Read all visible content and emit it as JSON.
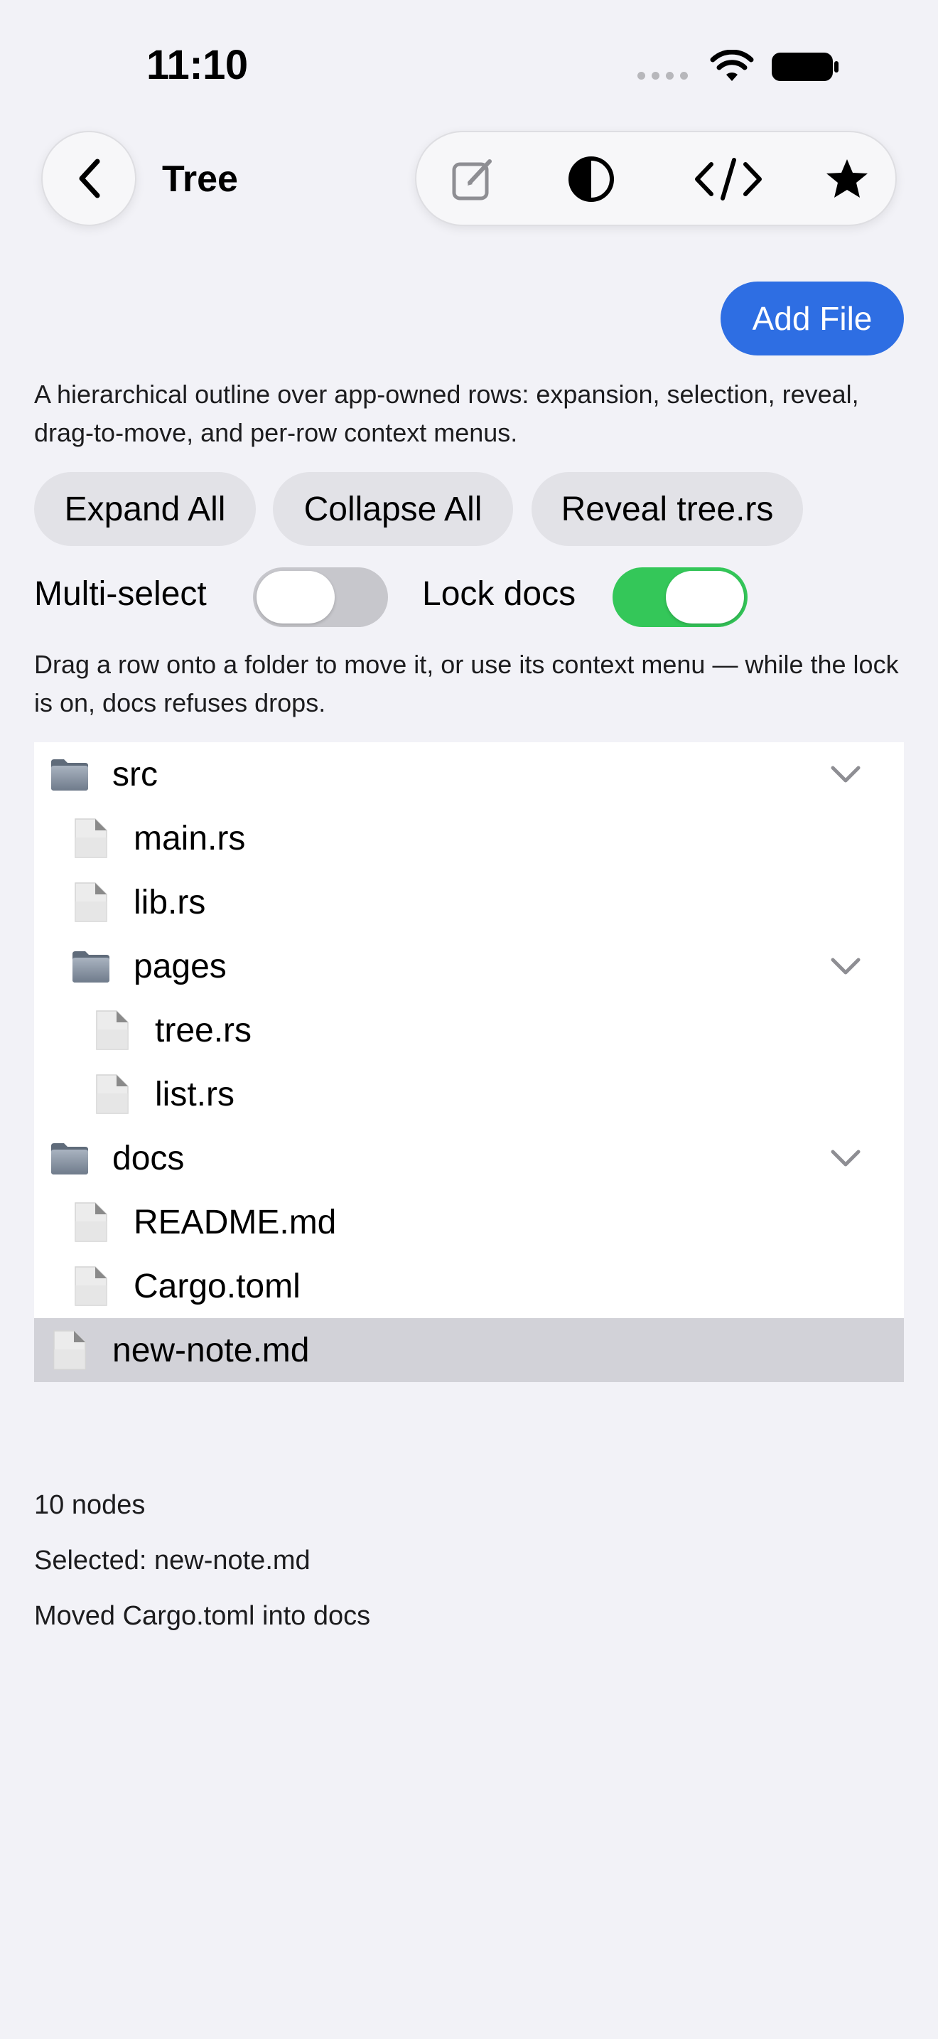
{
  "status": {
    "time": "11:10"
  },
  "nav": {
    "title": "Tree"
  },
  "toolbar": {
    "items": [
      {
        "icon": "compose-icon"
      },
      {
        "icon": "contrast-icon"
      },
      {
        "icon": "code-icon"
      },
      {
        "icon": "star-icon"
      }
    ]
  },
  "actions": {
    "add_file": "Add File"
  },
  "description": "A hierarchical outline over app-owned rows: expansion, selection, reveal, drag-to-move, and per-row context menus.",
  "buttons": {
    "expand_all": "Expand All",
    "collapse_all": "Collapse All",
    "reveal": "Reveal tree.rs"
  },
  "toggles": {
    "multi_select": {
      "label": "Multi-select",
      "on": false
    },
    "lock_docs": {
      "label": "Lock docs",
      "on": true
    }
  },
  "hint": "Drag a row onto a folder to move it, or use its context menu — while the lock is on, docs refuses drops.",
  "tree": {
    "rows": [
      {
        "label": "src",
        "type": "folder",
        "depth": 0,
        "expanded": true
      },
      {
        "label": "main.rs",
        "type": "file",
        "depth": 1
      },
      {
        "label": "lib.rs",
        "type": "file",
        "depth": 1
      },
      {
        "label": "pages",
        "type": "folder",
        "depth": 1,
        "expanded": true
      },
      {
        "label": "tree.rs",
        "type": "file",
        "depth": 2
      },
      {
        "label": "list.rs",
        "type": "file",
        "depth": 2
      },
      {
        "label": "docs",
        "type": "folder",
        "depth": 0,
        "expanded": true
      },
      {
        "label": "README.md",
        "type": "file",
        "depth": 1
      },
      {
        "label": "Cargo.toml",
        "type": "file",
        "depth": 1
      },
      {
        "label": "new-note.md",
        "type": "file",
        "depth": 0,
        "selected": true
      }
    ]
  },
  "footer": {
    "count": "10 nodes",
    "selected": "Selected: new-note.md",
    "last_action": "Moved Cargo.toml into docs"
  },
  "colors": {
    "accent": "#2e6ee3",
    "toggle_on": "#34c759",
    "toggle_off": "#c7c7cc",
    "background": "#f2f2f7",
    "selection": "#d2d2d8"
  }
}
